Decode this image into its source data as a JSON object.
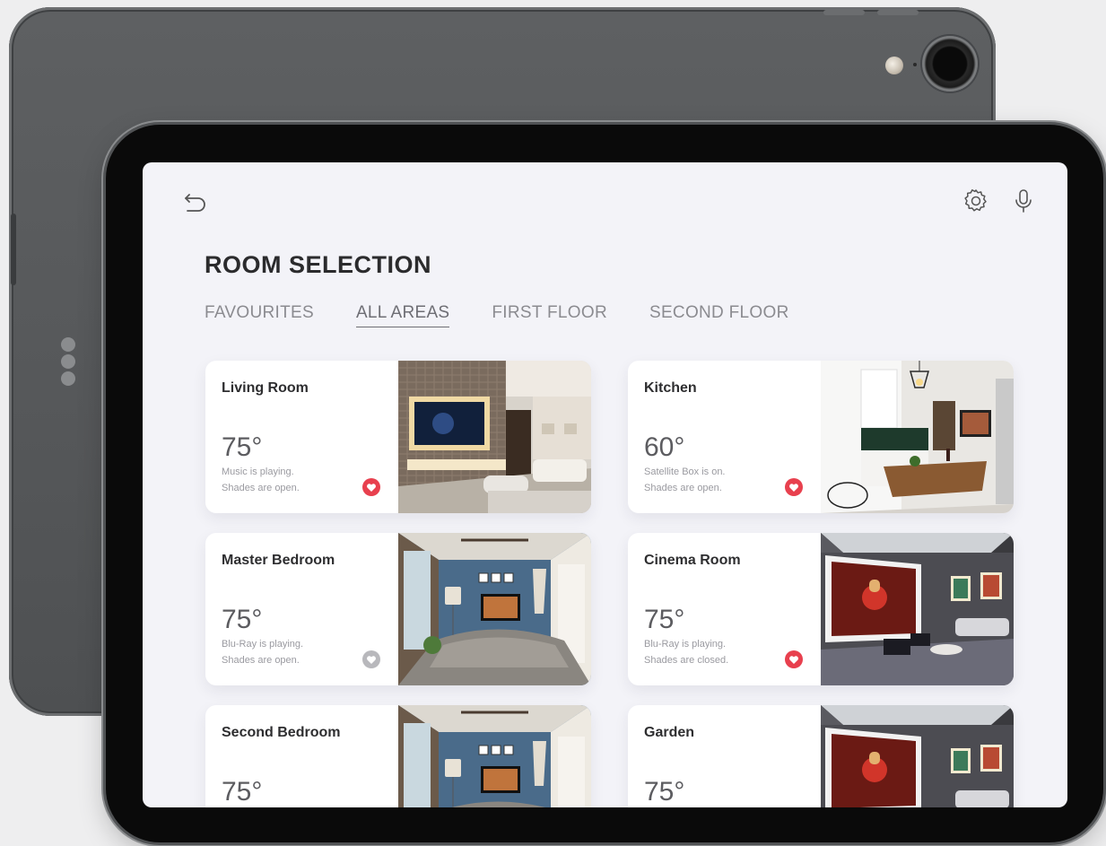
{
  "header": {
    "title": "ROOM SELECTION",
    "back_icon": "back-arrow-icon",
    "settings_icon": "gear-icon",
    "voice_icon": "microphone-icon"
  },
  "tabs": [
    {
      "label": "FAVOURITES",
      "active": false
    },
    {
      "label": "ALL AREAS",
      "active": true
    },
    {
      "label": "FIRST FLOOR",
      "active": false
    },
    {
      "label": "SECOND FLOOR",
      "active": false
    }
  ],
  "rooms": [
    {
      "name": "Living Room",
      "temp": "75°",
      "line1": "Music is playing.",
      "line2": "Shades are open.",
      "favourite": true
    },
    {
      "name": "Kitchen",
      "temp": "60°",
      "line1": "Satellite Box is on.",
      "line2": "Shades are open.",
      "favourite": true
    },
    {
      "name": "Master Bedroom",
      "temp": "75°",
      "line1": "Blu-Ray is playing.",
      "line2": "Shades are open.",
      "favourite": false
    },
    {
      "name": "Cinema Room",
      "temp": "75°",
      "line1": "Blu-Ray is playing.",
      "line2": "Shades are closed.",
      "favourite": true
    },
    {
      "name": "Second Bedroom",
      "temp": "75°",
      "line1": "",
      "line2": "",
      "favourite": false
    },
    {
      "name": "Garden",
      "temp": "75°",
      "line1": "",
      "line2": "",
      "favourite": false
    }
  ],
  "colors": {
    "favourite_on": "#e8404e",
    "favourite_off": "#b8b8bc",
    "screen_bg": "#f3f3f8"
  }
}
